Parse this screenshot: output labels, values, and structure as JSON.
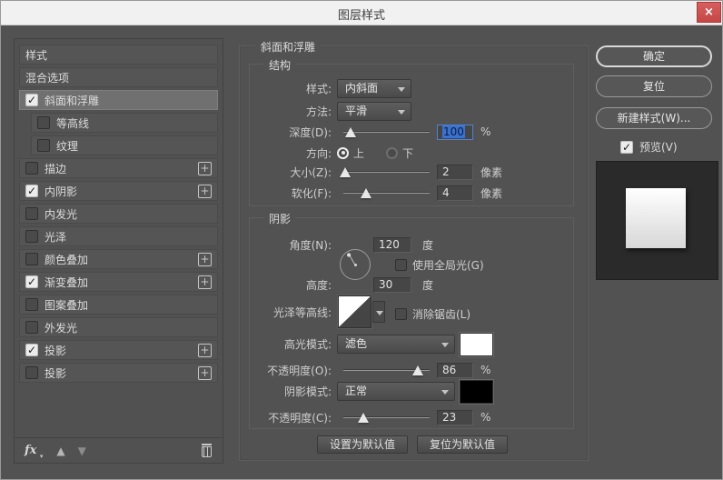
{
  "window": {
    "title": "图层样式",
    "close_icon": "×"
  },
  "sidebar": {
    "items": [
      {
        "label": "样式"
      },
      {
        "label": "混合选项"
      },
      {
        "label": "斜面和浮雕",
        "checked": true,
        "selected": true
      },
      {
        "label": "等高线",
        "checked": false
      },
      {
        "label": "纹理",
        "checked": false
      },
      {
        "label": "描边",
        "checked": false,
        "plus": true
      },
      {
        "label": "内阴影",
        "checked": true,
        "plus": true
      },
      {
        "label": "内发光",
        "checked": false
      },
      {
        "label": "光泽",
        "checked": false
      },
      {
        "label": "颜色叠加",
        "checked": false,
        "plus": true
      },
      {
        "label": "渐变叠加",
        "checked": true,
        "plus": true
      },
      {
        "label": "图案叠加",
        "checked": false
      },
      {
        "label": "外发光",
        "checked": false
      },
      {
        "label": "投影",
        "checked": true,
        "plus": true
      },
      {
        "label": "投影2",
        "checked": false,
        "plus": true,
        "label_display": "投影"
      }
    ]
  },
  "main": {
    "title": "斜面和浮雕",
    "structure": {
      "legend": "结构",
      "style_label": "样式:",
      "style_value": "内斜面",
      "technique_label": "方法:",
      "technique_value": "平滑",
      "depth_label": "深度(D):",
      "depth_value": "100",
      "depth_unit": "%",
      "direction_label": "方向:",
      "direction_up": "上",
      "direction_down": "下",
      "direction_selected": "up",
      "size_label": "大小(Z):",
      "size_value": "2",
      "size_unit": "像素",
      "soften_label": "软化(F):",
      "soften_value": "4",
      "soften_unit": "像素"
    },
    "shading": {
      "legend": "阴影",
      "angle_label": "角度(N):",
      "angle_value": "120",
      "angle_unit": "度",
      "use_global_light": "使用全局光(G)",
      "use_global_light_checked": false,
      "altitude_label": "高度:",
      "altitude_value": "30",
      "altitude_unit": "度",
      "gloss_contour_label": "光泽等高线:",
      "anti_aliased": "消除锯齿(L)",
      "anti_aliased_checked": false,
      "highlight_mode_label": "高光模式:",
      "highlight_mode_value": "滤色",
      "highlight_opacity_label": "不透明度(O):",
      "highlight_opacity_value": "86",
      "highlight_opacity_unit": "%",
      "shadow_mode_label": "阴影模式:",
      "shadow_mode_value": "正常",
      "shadow_opacity_label": "不透明度(C):",
      "shadow_opacity_value": "23",
      "shadow_opacity_unit": "%"
    },
    "defaults": {
      "set": "设置为默认值",
      "reset": "复位为默认值"
    }
  },
  "actions": {
    "ok": "确定",
    "reset": "复位",
    "new_style": "新建样式(W)...",
    "preview": "预览(V)",
    "preview_checked": true
  },
  "colors": {
    "dialog_bg": "#525252",
    "titlebar_bg": "#f1f1f1",
    "close_red": "#cd4e4e",
    "selection_blue": "#3b71cf",
    "highlight_swatch": "#ffffff",
    "shadow_swatch": "#000000",
    "preview_bg": "#2a2a2a"
  }
}
